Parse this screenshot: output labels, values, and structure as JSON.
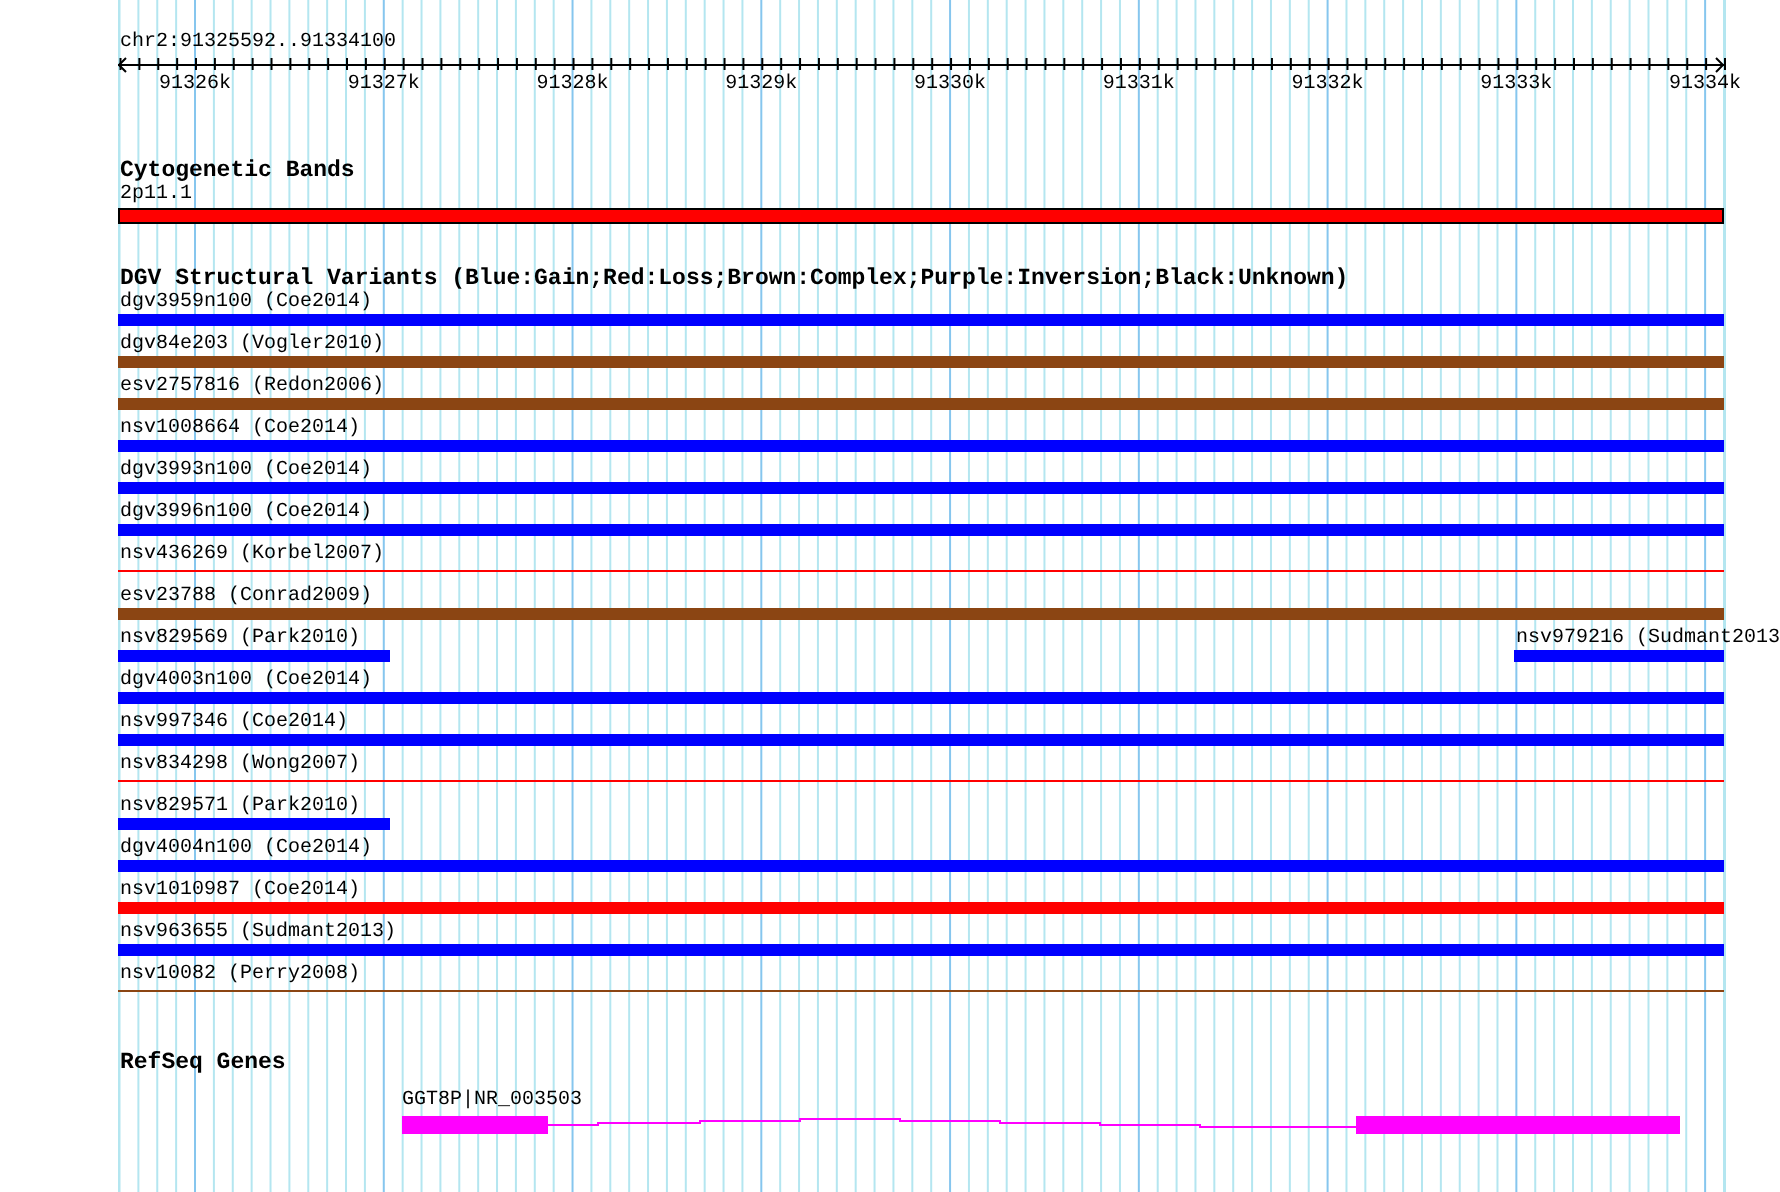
{
  "ruler": {
    "region": "chr2:91325592..91334100",
    "ticks": [
      "91326k",
      "91327k",
      "91328k",
      "91329k",
      "91330k",
      "91331k",
      "91332k",
      "91333k",
      "91334k"
    ]
  },
  "cytogenetic_bands": {
    "title": "Cytogenetic Bands",
    "band": {
      "label": "2p11.1",
      "color": "#ff0000"
    }
  },
  "dgv": {
    "title": "DGV Structural Variants (Blue:Gain;Red:Loss;Brown:Complex;Purple:Inversion;Black:Unknown)",
    "rows": [
      {
        "items": [
          {
            "label": "dgv3959n100 (Coe2014)",
            "color": "#0000ff",
            "kind": "bar",
            "full": true
          }
        ]
      },
      {
        "items": [
          {
            "label": "dgv84e203 (Vogler2010)",
            "color": "#8b4513",
            "kind": "bar",
            "full": true
          }
        ]
      },
      {
        "items": [
          {
            "label": "esv2757816 (Redon2006)",
            "color": "#8b4513",
            "kind": "bar",
            "full": true
          }
        ]
      },
      {
        "items": [
          {
            "label": "nsv1008664 (Coe2014)",
            "color": "#0000ff",
            "kind": "bar",
            "full": true
          }
        ]
      },
      {
        "items": [
          {
            "label": "dgv3993n100 (Coe2014)",
            "color": "#0000ff",
            "kind": "bar",
            "full": true
          }
        ]
      },
      {
        "items": [
          {
            "label": "dgv3996n100 (Coe2014)",
            "color": "#0000ff",
            "kind": "bar",
            "full": true
          }
        ]
      },
      {
        "items": [
          {
            "label": "nsv436269 (Korbel2007)",
            "color": "#ff0000",
            "kind": "line",
            "full": true
          }
        ]
      },
      {
        "items": [
          {
            "label": "esv23788 (Conrad2009)",
            "color": "#8b4513",
            "kind": "bar",
            "full": true
          }
        ]
      },
      {
        "items": [
          {
            "label": "nsv829569 (Park2010)",
            "color": "#0000ff",
            "kind": "bar",
            "full": false,
            "right": false
          },
          {
            "label": "nsv979216 (Sudmant2013",
            "color": "#0000ff",
            "kind": "bar",
            "full": false,
            "right": true
          }
        ]
      },
      {
        "items": [
          {
            "label": "dgv4003n100 (Coe2014)",
            "color": "#0000ff",
            "kind": "bar",
            "full": true
          }
        ]
      },
      {
        "items": [
          {
            "label": "nsv997346 (Coe2014)",
            "color": "#0000ff",
            "kind": "bar",
            "full": true
          }
        ]
      },
      {
        "items": [
          {
            "label": "nsv834298 (Wong2007)",
            "color": "#ff0000",
            "kind": "line",
            "full": true
          }
        ]
      },
      {
        "items": [
          {
            "label": "nsv829571 (Park2010)",
            "color": "#0000ff",
            "kind": "bar",
            "full": false,
            "right": false
          }
        ]
      },
      {
        "items": [
          {
            "label": "dgv4004n100 (Coe2014)",
            "color": "#0000ff",
            "kind": "bar",
            "full": true
          }
        ]
      },
      {
        "items": [
          {
            "label": "nsv1010987 (Coe2014)",
            "color": "#ff0000",
            "kind": "bar",
            "full": true
          }
        ]
      },
      {
        "items": [
          {
            "label": "nsv963655 (Sudmant2013)",
            "color": "#0000ff",
            "kind": "bar",
            "full": true
          }
        ]
      },
      {
        "items": [
          {
            "label": "nsv10082 (Perry2008)",
            "color": "#8b4513",
            "kind": "line",
            "full": true
          }
        ]
      }
    ]
  },
  "refseq_genes": {
    "title": "RefSeq Genes",
    "gene": {
      "label": "GGT8P|NR_003503"
    }
  }
}
